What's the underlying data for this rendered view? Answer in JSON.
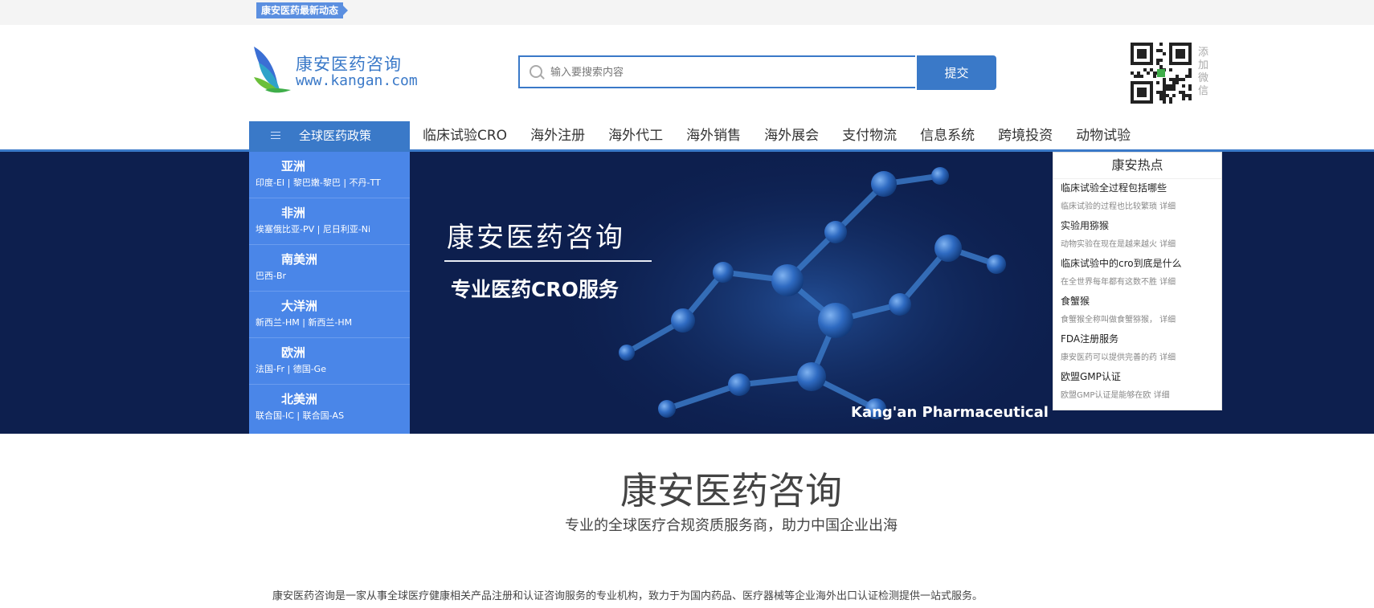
{
  "topbar": {
    "badge": "康安医药最新动态"
  },
  "logo": {
    "title": "康安医药咨询",
    "url": "www.kangan.com"
  },
  "search": {
    "placeholder": "输入要搜索内容",
    "submit_label": "提交"
  },
  "wechat": {
    "label": "添加微信"
  },
  "nav": {
    "category_label": "全球医药政策",
    "items": [
      "临床试验CRO",
      "海外注册",
      "海外代工",
      "海外销售",
      "海外展会",
      "支付物流",
      "信息系统",
      "跨境投资",
      "动物试验"
    ]
  },
  "continents": [
    {
      "name": "亚洲",
      "countries": "印度-EI | 黎巴嫩-黎巴 | 不丹-TT"
    },
    {
      "name": "非洲",
      "countries": "埃塞俄比亚-PV | 尼日利亚-Ni"
    },
    {
      "name": "南美洲",
      "countries": "巴西-Br"
    },
    {
      "name": "大洋洲",
      "countries": "新西兰-HM | 新西兰-HM"
    },
    {
      "name": "欧洲",
      "countries": "法国-Fr | 德国-Ge"
    },
    {
      "name": "北美洲",
      "countries": "联合国-IC | 联合国-AS"
    }
  ],
  "banner": {
    "title": "康安医药咨询",
    "subtitle": "专业医药CRO服务",
    "brand": "Kang'an Pharmaceutical"
  },
  "hot": {
    "title": "康安热点",
    "items": [
      {
        "title": "临床试验全过程包括哪些",
        "desc": "临床试验的过程也比较繁琐 详细"
      },
      {
        "title": "实验用猕猴",
        "desc": "动物实验在现在是越来越火 详细"
      },
      {
        "title": "临床试验中的cro到底是什么",
        "desc": "在全世界每年都有这数不胜 详细"
      },
      {
        "title": "食蟹猴",
        "desc": "食蟹猴全称叫做食蟹猕猴， 详细"
      },
      {
        "title": "FDA注册服务",
        "desc": "康安医药可以提供完善的药 详细"
      },
      {
        "title": "欧盟GMP认证",
        "desc": "欧盟GMP认证是能够在欧 详细"
      }
    ]
  },
  "about": {
    "title": "康安医药咨询",
    "subtitle": "专业的全球医疗合规资质服务商，助力中国企业出海",
    "text": "康安医药咨询是一家从事全球医疗健康相关产品注册和认证咨询服务的专业机构，致力于为国内药品、医疗器械等企业海外出口认证检测提供一站式服务。"
  },
  "colors": {
    "brand": "#3a79c8",
    "continent_panel": "#4a86e8",
    "banner_bg": "#0d1f4e"
  }
}
